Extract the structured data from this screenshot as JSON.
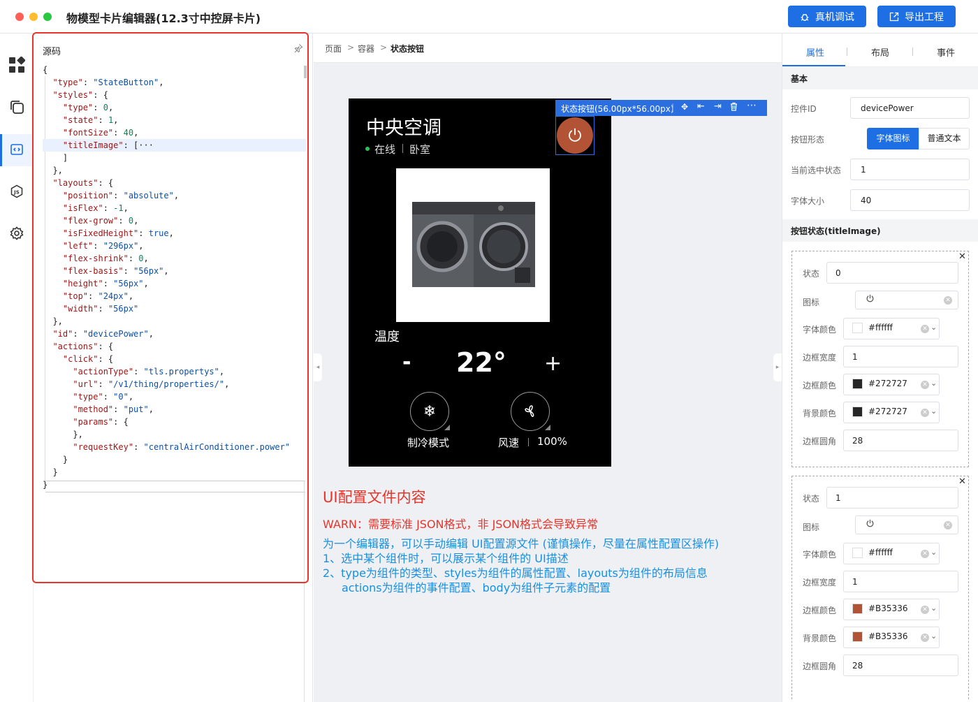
{
  "window": {
    "title": "物模型卡片编辑器(12.3寸中控屏卡片)"
  },
  "toolbar": {
    "debug_label": "真机调试",
    "export_label": "导出工程"
  },
  "source_panel": {
    "title": "源码",
    "lines": [
      "{",
      "  \"type\": \"StateButton\",",
      "  \"styles\": {",
      "    \"type\": 0,",
      "    \"state\": 1,",
      "    \"fontSize\": 40,",
      "    \"titleImage\": [···",
      "    ]",
      "  },",
      "  \"layouts\": {",
      "    \"position\": \"absolute\",",
      "    \"isFlex\": -1,",
      "    \"flex-grow\": 0,",
      "    \"isFixedHeight\": true,",
      "    \"left\": \"296px\",",
      "    \"flex-shrink\": 0,",
      "    \"flex-basis\": \"56px\",",
      "    \"height\": \"56px\",",
      "    \"top\": \"24px\",",
      "    \"width\": \"56px\"",
      "  },",
      "  \"id\": \"devicePower\",",
      "  \"actions\": {",
      "    \"click\": {",
      "      \"actionType\": \"tls.propertys\",",
      "      \"url\": \"/v1/thing/properties/\",",
      "      \"type\": \"0\",",
      "      \"method\": \"put\",",
      "      \"params\": {",
      "      },",
      "      \"requestKey\": \"centralAirConditioner.power\"",
      "    }",
      "  }",
      "}"
    ]
  },
  "breadcrumb": [
    "页面",
    "容器",
    "状态按钮"
  ],
  "selection": {
    "label": "状态按钮(56.00px*56.00px)"
  },
  "card": {
    "title": "中央空调",
    "status": "在线",
    "room": "卧室",
    "temp_label": "温度",
    "minus": "-",
    "temperature": "22°",
    "plus": "+",
    "mode_label": "制冷模式",
    "fan_label": "风速",
    "fan_value": "100%"
  },
  "notes": {
    "heading": "UI配置文件内容",
    "warn": "WARN：需要标准 JSON格式，非 JSON格式会导致异常",
    "line1": "为一个编辑器，可以手动编辑 UI配置源文件 (谨慎操作，尽量在属性配置区操作)",
    "line2": "1、选中某个组件时，可以展示某个组件的 UI描述",
    "line3": "2、type为组件的类型、styles为组件的属性配置、layouts为组件的布局信息",
    "line4": "actions为组件的事件配置、body为组件子元素的配置"
  },
  "props": {
    "tabs": [
      "属性",
      "布局",
      "事件"
    ],
    "basic_header": "基本",
    "control_id_label": "控件ID",
    "control_id_value": "devicePower",
    "button_form_label": "按钮形态",
    "form_options": [
      "字体图标",
      "普通文本"
    ],
    "current_state_label": "当前选中状态",
    "current_state_value": "1",
    "font_size_label": "字体大小",
    "font_size_value": "40",
    "states_header": "按钮状态(titleImage)",
    "state_label": "状态",
    "icon_label": "图标",
    "font_color_label": "字体颜色",
    "border_width_label": "边框宽度",
    "border_color_label": "边框颜色",
    "bg_color_label": "背景颜色",
    "radius_label": "边框圆角",
    "states": [
      {
        "state": "0",
        "font_color": "#ffffff",
        "border_width": "1",
        "border_color": "#272727",
        "bg_color": "#272727",
        "radius": "28"
      },
      {
        "state": "1",
        "font_color": "#ffffff",
        "border_width": "1",
        "border_color": "#B35336",
        "bg_color": "#B35336",
        "radius": "28"
      }
    ]
  },
  "colors": {
    "accent": "#1d6fe3",
    "warn": "#e8342a",
    "info": "#1a8fe0",
    "power": "#b35336"
  }
}
